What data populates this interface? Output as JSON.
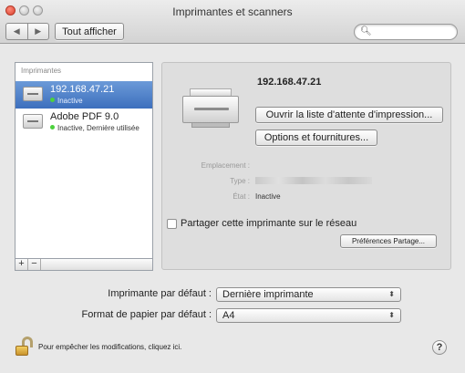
{
  "window": {
    "title": "Imprimantes et scanners"
  },
  "toolbar": {
    "back_icon": "◀",
    "forward_icon": "▶",
    "show_all_label": "Tout afficher",
    "search_icon": "🔍︎",
    "search_placeholder": ""
  },
  "list": {
    "header": "Imprimantes",
    "add_label": "+",
    "remove_label": "−",
    "printers": [
      {
        "name": "192.168.47.21",
        "status": "Inactive",
        "selected": true
      },
      {
        "name": "Adobe PDF 9.0",
        "status": "Inactive, Dernière utilisée",
        "selected": false
      }
    ]
  },
  "detail": {
    "printer_name": "192.168.47.21",
    "queue_button": "Ouvrir la liste d'attente d'impression...",
    "options_button": "Options et fournitures...",
    "location_label": "Emplacement :",
    "type_label": "Type :",
    "state_label": "État :",
    "state_value": "Inactive"
  },
  "sharing": {
    "share_label": "Partager cette imprimante sur le réseau",
    "share_checked": false,
    "prefs_button": "Préférences Partage..."
  },
  "defaults": {
    "printer_label": "Imprimante par défaut :",
    "printer_value": "Dernière imprimante",
    "paper_label": "Format de papier par défaut :",
    "paper_value": "A4",
    "popup_arrows": "⬍"
  },
  "footer": {
    "lock_text": "Pour empêcher les modifications, cliquez ici.",
    "help_label": "?"
  },
  "colors": {
    "selection": "#3d6fbd",
    "status_dot": "#4cd13d",
    "close_button": "#d9412d"
  }
}
